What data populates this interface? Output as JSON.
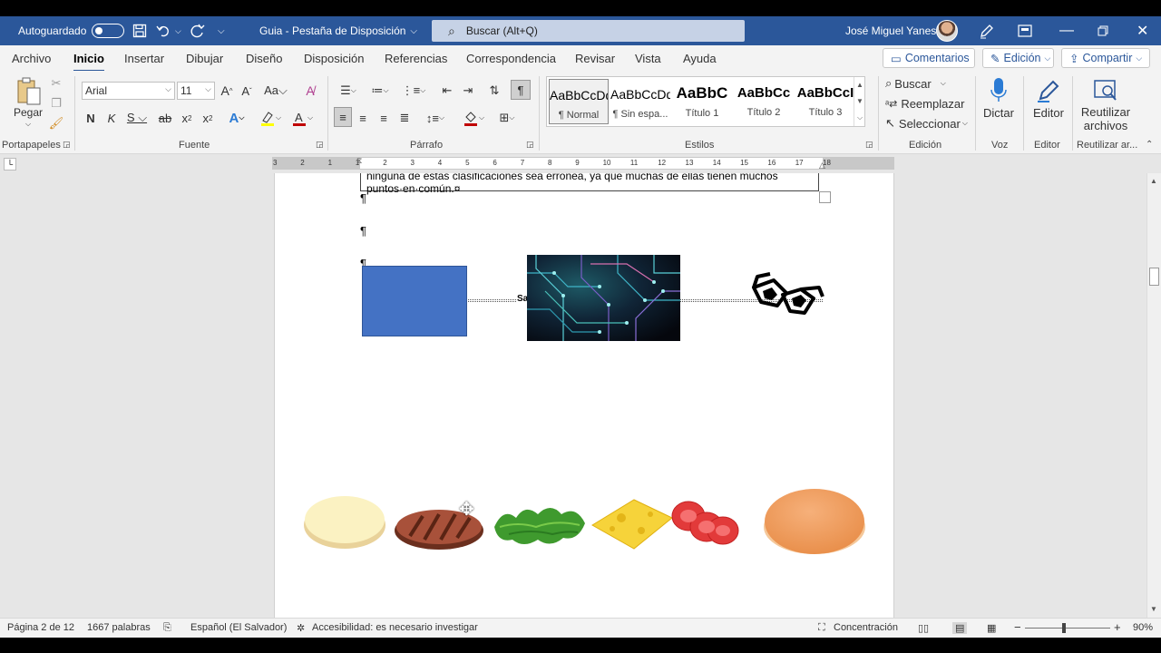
{
  "titlebar": {
    "autosave_label": "Autoguardado",
    "doc_title": "Guia - Pestaña de Disposición",
    "search_placeholder": "Buscar (Alt+Q)",
    "user_name": "José Miguel Yanes"
  },
  "tabs": [
    "Archivo",
    "Inicio",
    "Insertar",
    "Dibujar",
    "Diseño",
    "Disposición",
    "Referencias",
    "Correspondencia",
    "Revisar",
    "Vista",
    "Ayuda"
  ],
  "tab_buttons": {
    "comments": "Comentarios",
    "editing": "Edición",
    "share": "Compartir"
  },
  "ribbon": {
    "clipboard": {
      "paste": "Pegar",
      "group": "Portapapeles"
    },
    "font": {
      "name": "Arial",
      "size": "11",
      "group": "Fuente"
    },
    "paragraph": {
      "group": "Párrafo"
    },
    "styles": {
      "group": "Estilos",
      "items": [
        {
          "preview": "AaBbCcDd",
          "name": "¶ Normal"
        },
        {
          "preview": "AaBbCcDd",
          "name": "¶ Sin espa..."
        },
        {
          "preview": "AaBbC",
          "name": "Título 1"
        },
        {
          "preview": "AaBbCc",
          "name": "Título 2"
        },
        {
          "preview": "AaBbCcI",
          "name": "Título 3"
        }
      ]
    },
    "editing": {
      "find": "Buscar",
      "replace": "Reemplazar",
      "select": "Seleccionar",
      "group": "Edición"
    },
    "voice": {
      "dictate": "Dictar",
      "group": "Voz"
    },
    "editor": {
      "label": "Editor",
      "group": "Editor"
    },
    "reuse": {
      "label1": "Reutilizar",
      "label2": "archivos",
      "group": "Reutilizar ar..."
    }
  },
  "ruler": {
    "ticks": [
      "3",
      "2",
      "1",
      "1",
      "2",
      "3",
      "4",
      "5",
      "6",
      "7",
      "8",
      "9",
      "10",
      "11",
      "12",
      "13",
      "14",
      "15",
      "16",
      "17",
      "18"
    ]
  },
  "document": {
    "textbox_line1": "ninguna de estas clasificaciones sea errónea, ya que muchas de ellas tienen muchos",
    "textbox_line2": "puntos·en·común.¤",
    "pilcrow": "¶",
    "shape_label": "Sa"
  },
  "status": {
    "page": "Página 2 de 12",
    "words": "1667 palabras",
    "language": "Español (El Salvador)",
    "accessibility": "Accesibilidad: es necesario investigar",
    "focus": "Concentración",
    "zoom": "90%"
  },
  "colors": {
    "titlebar": "#2b579a",
    "rect_fill": "#4472c4"
  }
}
